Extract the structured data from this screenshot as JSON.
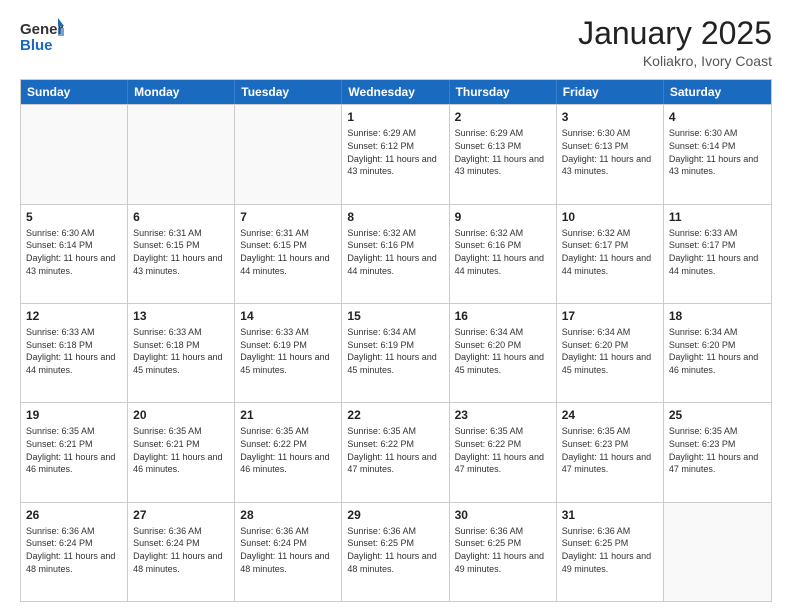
{
  "logo": {
    "text_general": "General",
    "text_blue": "Blue"
  },
  "header": {
    "title": "January 2025",
    "subtitle": "Koliakro, Ivory Coast"
  },
  "weekdays": [
    "Sunday",
    "Monday",
    "Tuesday",
    "Wednesday",
    "Thursday",
    "Friday",
    "Saturday"
  ],
  "rows": [
    [
      {
        "day": "",
        "empty": true
      },
      {
        "day": "",
        "empty": true
      },
      {
        "day": "",
        "empty": true
      },
      {
        "day": "1",
        "sunrise": "6:29 AM",
        "sunset": "6:12 PM",
        "daylight": "11 hours and 43 minutes."
      },
      {
        "day": "2",
        "sunrise": "6:29 AM",
        "sunset": "6:13 PM",
        "daylight": "11 hours and 43 minutes."
      },
      {
        "day": "3",
        "sunrise": "6:30 AM",
        "sunset": "6:13 PM",
        "daylight": "11 hours and 43 minutes."
      },
      {
        "day": "4",
        "sunrise": "6:30 AM",
        "sunset": "6:14 PM",
        "daylight": "11 hours and 43 minutes."
      }
    ],
    [
      {
        "day": "5",
        "sunrise": "6:30 AM",
        "sunset": "6:14 PM",
        "daylight": "11 hours and 43 minutes."
      },
      {
        "day": "6",
        "sunrise": "6:31 AM",
        "sunset": "6:15 PM",
        "daylight": "11 hours and 43 minutes."
      },
      {
        "day": "7",
        "sunrise": "6:31 AM",
        "sunset": "6:15 PM",
        "daylight": "11 hours and 44 minutes."
      },
      {
        "day": "8",
        "sunrise": "6:32 AM",
        "sunset": "6:16 PM",
        "daylight": "11 hours and 44 minutes."
      },
      {
        "day": "9",
        "sunrise": "6:32 AM",
        "sunset": "6:16 PM",
        "daylight": "11 hours and 44 minutes."
      },
      {
        "day": "10",
        "sunrise": "6:32 AM",
        "sunset": "6:17 PM",
        "daylight": "11 hours and 44 minutes."
      },
      {
        "day": "11",
        "sunrise": "6:33 AM",
        "sunset": "6:17 PM",
        "daylight": "11 hours and 44 minutes."
      }
    ],
    [
      {
        "day": "12",
        "sunrise": "6:33 AM",
        "sunset": "6:18 PM",
        "daylight": "11 hours and 44 minutes."
      },
      {
        "day": "13",
        "sunrise": "6:33 AM",
        "sunset": "6:18 PM",
        "daylight": "11 hours and 45 minutes."
      },
      {
        "day": "14",
        "sunrise": "6:33 AM",
        "sunset": "6:19 PM",
        "daylight": "11 hours and 45 minutes."
      },
      {
        "day": "15",
        "sunrise": "6:34 AM",
        "sunset": "6:19 PM",
        "daylight": "11 hours and 45 minutes."
      },
      {
        "day": "16",
        "sunrise": "6:34 AM",
        "sunset": "6:20 PM",
        "daylight": "11 hours and 45 minutes."
      },
      {
        "day": "17",
        "sunrise": "6:34 AM",
        "sunset": "6:20 PM",
        "daylight": "11 hours and 45 minutes."
      },
      {
        "day": "18",
        "sunrise": "6:34 AM",
        "sunset": "6:20 PM",
        "daylight": "11 hours and 46 minutes."
      }
    ],
    [
      {
        "day": "19",
        "sunrise": "6:35 AM",
        "sunset": "6:21 PM",
        "daylight": "11 hours and 46 minutes."
      },
      {
        "day": "20",
        "sunrise": "6:35 AM",
        "sunset": "6:21 PM",
        "daylight": "11 hours and 46 minutes."
      },
      {
        "day": "21",
        "sunrise": "6:35 AM",
        "sunset": "6:22 PM",
        "daylight": "11 hours and 46 minutes."
      },
      {
        "day": "22",
        "sunrise": "6:35 AM",
        "sunset": "6:22 PM",
        "daylight": "11 hours and 47 minutes."
      },
      {
        "day": "23",
        "sunrise": "6:35 AM",
        "sunset": "6:22 PM",
        "daylight": "11 hours and 47 minutes."
      },
      {
        "day": "24",
        "sunrise": "6:35 AM",
        "sunset": "6:23 PM",
        "daylight": "11 hours and 47 minutes."
      },
      {
        "day": "25",
        "sunrise": "6:35 AM",
        "sunset": "6:23 PM",
        "daylight": "11 hours and 47 minutes."
      }
    ],
    [
      {
        "day": "26",
        "sunrise": "6:36 AM",
        "sunset": "6:24 PM",
        "daylight": "11 hours and 48 minutes."
      },
      {
        "day": "27",
        "sunrise": "6:36 AM",
        "sunset": "6:24 PM",
        "daylight": "11 hours and 48 minutes."
      },
      {
        "day": "28",
        "sunrise": "6:36 AM",
        "sunset": "6:24 PM",
        "daylight": "11 hours and 48 minutes."
      },
      {
        "day": "29",
        "sunrise": "6:36 AM",
        "sunset": "6:25 PM",
        "daylight": "11 hours and 48 minutes."
      },
      {
        "day": "30",
        "sunrise": "6:36 AM",
        "sunset": "6:25 PM",
        "daylight": "11 hours and 49 minutes."
      },
      {
        "day": "31",
        "sunrise": "6:36 AM",
        "sunset": "6:25 PM",
        "daylight": "11 hours and 49 minutes."
      },
      {
        "day": "",
        "empty": true
      }
    ]
  ]
}
